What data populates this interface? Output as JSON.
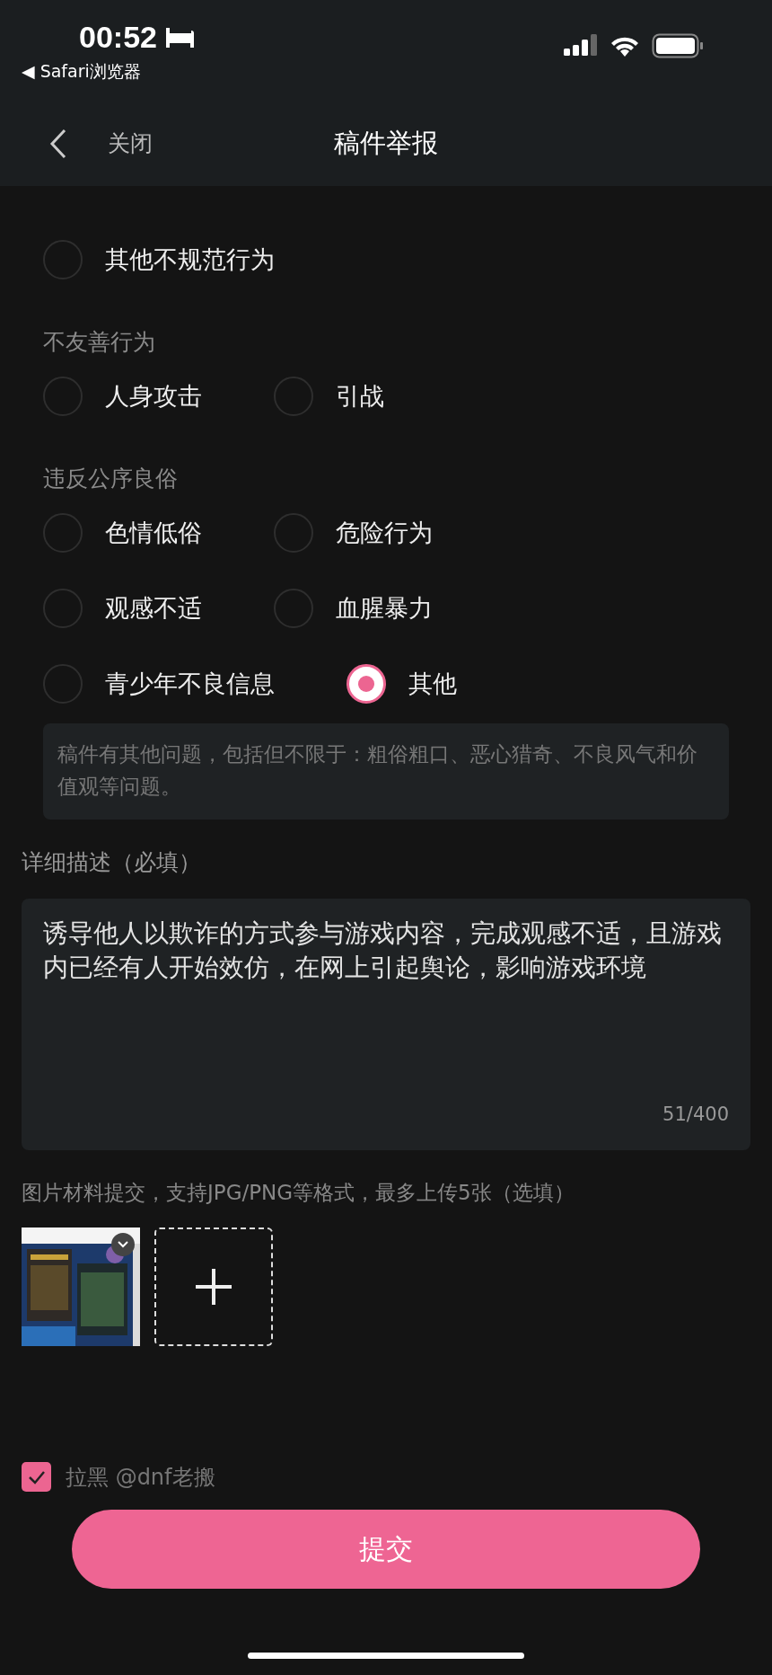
{
  "status_bar": {
    "time": "00:52",
    "back_app": "◀ Safari浏览器"
  },
  "nav": {
    "close": "关闭",
    "title": "稿件举报"
  },
  "sections": [
    {
      "rows": [
        [
          {
            "label": "其他不规范行为",
            "selected": false
          }
        ]
      ]
    },
    {
      "heading": "不友善行为",
      "rows": [
        [
          {
            "label": "人身攻击",
            "selected": false
          },
          {
            "label": "引战",
            "selected": false
          }
        ]
      ]
    },
    {
      "heading": "违反公序良俗",
      "rows": [
        [
          {
            "label": "色情低俗",
            "selected": false
          },
          {
            "label": "危险行为",
            "selected": false
          }
        ],
        [
          {
            "label": "观感不适",
            "selected": false
          },
          {
            "label": "血腥暴力",
            "selected": false
          }
        ],
        [
          {
            "label": "青少年不良信息",
            "selected": false
          },
          {
            "label": "其他",
            "selected": true
          }
        ]
      ]
    }
  ],
  "other_note": "稿件有其他问题，包括但不限于：粗俗粗口、恶心猎奇、不良风气和价值观等问题。",
  "description": {
    "label": "详细描述（必填）",
    "value": "诱导他人以欺诈的方式参与游戏内容，完成观感不适，且游戏内已经有人开始效仿，在网上引起舆论，影响游戏环境",
    "counter": "51/400"
  },
  "upload": {
    "hint": "图片材料提交，支持JPG/PNG等格式，最多上传5张（选填）"
  },
  "block": {
    "label": "拉黑 @dnf老搬",
    "checked": true
  },
  "submit": "提交"
}
